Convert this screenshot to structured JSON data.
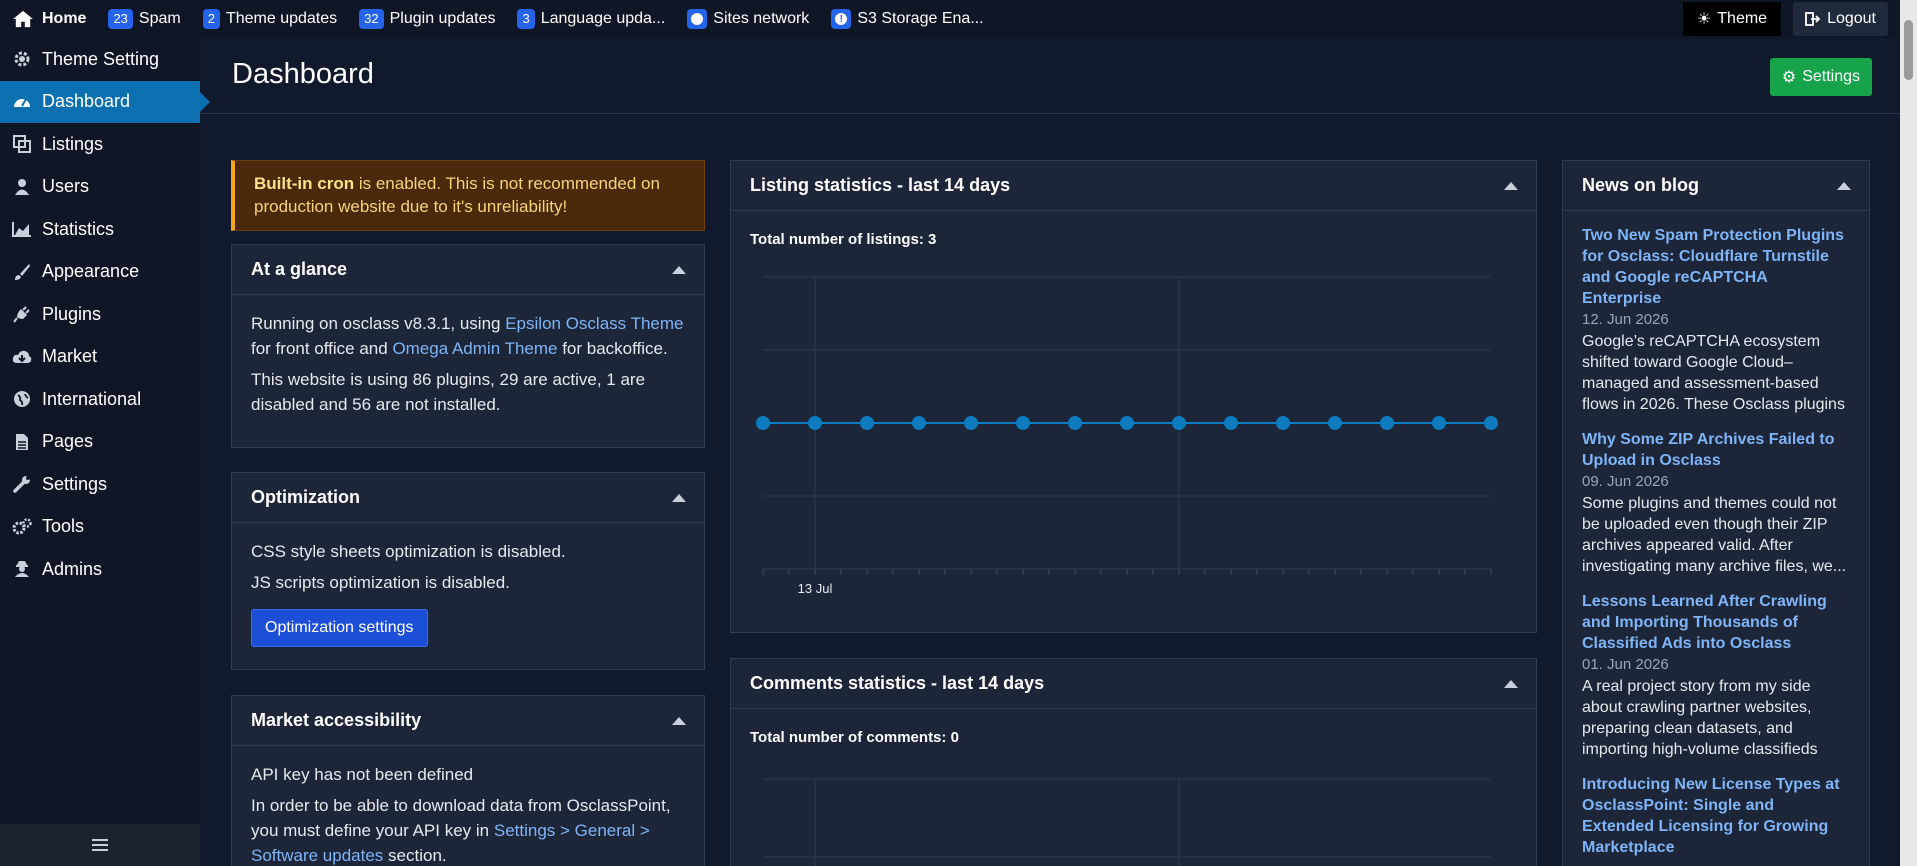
{
  "topbar": {
    "home": "Home",
    "items": [
      {
        "badge": "23",
        "label": "Spam"
      },
      {
        "badge": "2",
        "label": "Theme updates"
      },
      {
        "badge": "32",
        "label": "Plugin updates"
      },
      {
        "badge": "3",
        "label": "Language upda..."
      }
    ],
    "sites_network": "Sites network",
    "s3": "S3 Storage Ena...",
    "theme": "Theme",
    "logout": "Logout"
  },
  "sidebar": {
    "items": [
      {
        "label": "Theme Setting",
        "icon": "gear-icon"
      },
      {
        "label": "Dashboard",
        "icon": "gauge-icon"
      },
      {
        "label": "Listings",
        "icon": "copy-icon"
      },
      {
        "label": "Users",
        "icon": "user-icon"
      },
      {
        "label": "Statistics",
        "icon": "area-chart-icon"
      },
      {
        "label": "Appearance",
        "icon": "brush-icon"
      },
      {
        "label": "Plugins",
        "icon": "plug-icon"
      },
      {
        "label": "Market",
        "icon": "cloud-download-icon"
      },
      {
        "label": "International",
        "icon": "globe-icon"
      },
      {
        "label": "Pages",
        "icon": "file-icon"
      },
      {
        "label": "Settings",
        "icon": "wrench-icon"
      },
      {
        "label": "Tools",
        "icon": "gears-icon"
      },
      {
        "label": "Admins",
        "icon": "user-secret-icon"
      }
    ]
  },
  "header": {
    "title": "Dashboard",
    "settings": "Settings"
  },
  "alert": {
    "strong": "Built-in cron",
    "text": " is enabled. This is not recommended on production website due to it's unreliability!"
  },
  "glance": {
    "title": "At a glance",
    "line1_a": "Running on osclass v8.3.1, using ",
    "theme_link": "Epsilon Osclass Theme",
    "line1_b": " for front office and ",
    "admin_link": "Omega Admin Theme",
    "line1_c": " for backoffice.",
    "line2": "This website is using 86 plugins, 29 are active, 1 are disabled and 56 are not installed."
  },
  "optimization": {
    "title": "Optimization",
    "css": "CSS style sheets optimization is disabled.",
    "js": "JS scripts optimization is disabled.",
    "button": "Optimization settings"
  },
  "market": {
    "title": "Market accessibility",
    "line1": "API key has not been defined",
    "line2_a": "In order to be able to download data from OsclassPoint, you must define your API key in ",
    "link": "Settings > General > Software updates",
    "line2_b": " section."
  },
  "listing_stats": {
    "title": "Listing statistics - last 14 days",
    "total": "Total number of listings: 3"
  },
  "comments_stats": {
    "title": "Comments statistics - last 14 days",
    "total": "Total number of comments: 0"
  },
  "chart_data": {
    "type": "line",
    "title": "Listing statistics - last 14 days",
    "x": [
      "",
      "13 Jul",
      "",
      "",
      "",
      "",
      "",
      "",
      "",
      "",
      "",
      "",
      "",
      "",
      ""
    ],
    "series": [
      {
        "values": [
          0,
          0,
          0,
          0,
          0,
          0,
          0,
          0,
          0,
          0,
          0,
          0,
          0,
          0,
          0
        ]
      }
    ],
    "grid": true,
    "color": "#0c7bbf"
  },
  "news": {
    "title": "News on blog",
    "items": [
      {
        "title": "Two New Spam Protection Plugins for Osclass: Cloudflare Turnstile and Google reCAPTCHA Enterprise",
        "date": "12. Jun 2026",
        "text": "Google’s reCAPTCHA ecosystem shifted toward Google Cloud–managed and assessment-based flows in 2026. These Osclass plugins"
      },
      {
        "title": "Why Some ZIP Archives Failed to Upload in Osclass",
        "date": "09. Jun 2026",
        "text": "Some plugins and themes could not be uploaded even though their ZIP archives appeared valid. After investigating many archive files, we..."
      },
      {
        "title": "Lessons Learned After Crawling and Importing Thousands of Classified Ads into Osclass",
        "date": "01. Jun 2026",
        "text": "A real project story from my side about crawling partner websites, preparing clean datasets, and importing high-volume classifieds"
      },
      {
        "title": "Introducing New License Types at OsclassPoint: Single and Extended Licensing for Growing Marketplace",
        "date": "",
        "text": ""
      }
    ]
  }
}
